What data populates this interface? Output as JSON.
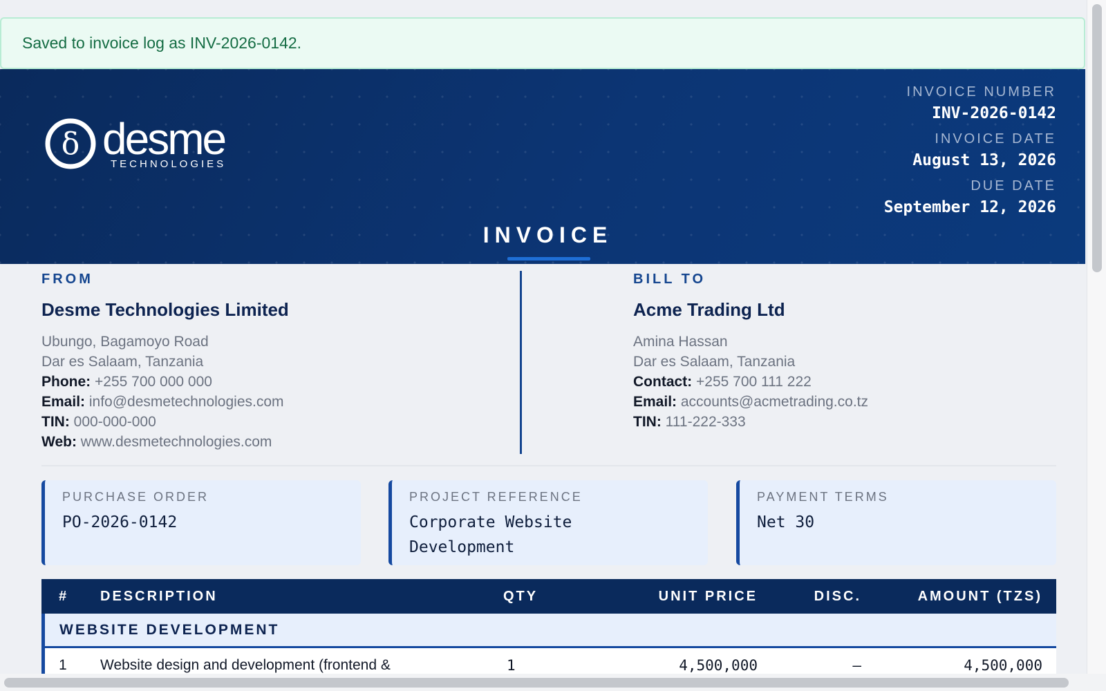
{
  "toast": {
    "message": "Saved to invoice log as INV-2026-0142."
  },
  "brand": {
    "word": "desme",
    "tagline": "TECHNOLOGIES",
    "mark_glyph": "δ",
    "header_color": "#0a2a5c",
    "accent_color": "#1549a0"
  },
  "meta": {
    "invoice_number_label": "INVOICE NUMBER",
    "invoice_number": "INV-2026-0142",
    "invoice_date_label": "INVOICE DATE",
    "invoice_date": "August 13, 2026",
    "due_date_label": "DUE DATE",
    "due_date": "September 12, 2026"
  },
  "title": "INVOICE",
  "from": {
    "section": "FROM",
    "name": "Desme Technologies Limited",
    "address1": "Ubungo, Bagamoyo Road",
    "address2": "Dar es Salaam, Tanzania",
    "phone_label": "Phone:",
    "phone": "+255 700 000 000",
    "email_label": "Email:",
    "email": "info@desmetechnologies.com",
    "tin_label": "TIN:",
    "tin": "000-000-000",
    "web_label": "Web:",
    "web": "www.desmetechnologies.com"
  },
  "bill_to": {
    "section": "BILL TO",
    "name": "Acme Trading Ltd",
    "contact_name": "Amina Hassan",
    "address": "Dar es Salaam, Tanzania",
    "contact_label": "Contact:",
    "contact": "+255 700 111 222",
    "email_label": "Email:",
    "email": "accounts@acmetrading.co.tz",
    "tin_label": "TIN:",
    "tin": "111-222-333"
  },
  "info": {
    "po_label": "PURCHASE ORDER",
    "po": "PO-2026-0142",
    "project_label": "PROJECT REFERENCE",
    "project_line1": "Corporate Website",
    "project_line2": "Development",
    "terms_label": "PAYMENT TERMS",
    "terms": "Net 30"
  },
  "table": {
    "columns": {
      "num": "#",
      "description": "DESCRIPTION",
      "qty": "QTY",
      "unit_price": "UNIT PRICE",
      "disc": "DISC.",
      "amount": "AMOUNT (TZS)"
    },
    "group": "WEBSITE DEVELOPMENT",
    "rows": [
      {
        "num": "1",
        "description": "Website design and development (frontend &",
        "qty": "1",
        "unit_price": "4,500,000",
        "disc": "—",
        "amount": "4,500,000"
      }
    ]
  }
}
